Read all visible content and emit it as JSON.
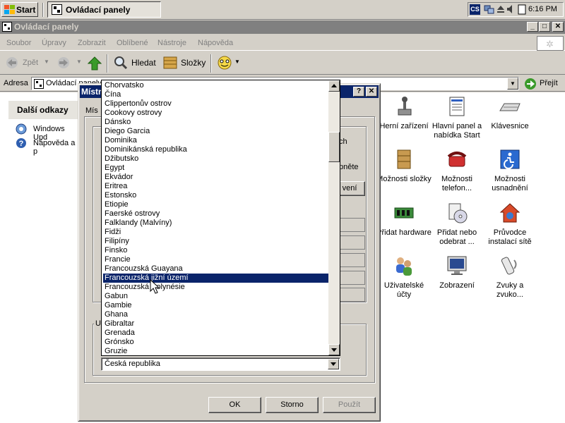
{
  "taskbar": {
    "start_label": "Start",
    "task_label": "Ovládací panely",
    "tray_lang": "CS",
    "clock": "6:16 PM"
  },
  "window": {
    "title": "Ovládací panely",
    "minimize": "_",
    "maximize": "□",
    "close": "✕"
  },
  "menu": [
    "Soubor",
    "Úpravy",
    "Zobrazit",
    "Oblíbené",
    "Nástroje",
    "Nápověda"
  ],
  "toolbar": {
    "back": "Zpět",
    "search": "Hledat",
    "folders": "Složky"
  },
  "address": {
    "label": "Adresa",
    "value": "Ovládací panely",
    "go": "Přejít"
  },
  "left_panel": {
    "heading": "Další odkazy",
    "links": [
      "Windows Upd",
      "Nápověda a p"
    ]
  },
  "cp_items": [
    {
      "label": "Herní zařízení"
    },
    {
      "label": "Hlavní panel a nabídka Start"
    },
    {
      "label": "Klávesnice"
    },
    {
      "label": "Možnosti složky"
    },
    {
      "label": "Možnosti telefon..."
    },
    {
      "label": "Možnosti usnadnění"
    },
    {
      "label": "Přidat hardware"
    },
    {
      "label": "Přidat nebo odebrat ..."
    },
    {
      "label": "Průvodce instalací sítě"
    },
    {
      "label": "Uživatelské účty"
    },
    {
      "label": "Zobrazení"
    },
    {
      "label": "Zvuky a zvuko..."
    }
  ],
  "dialog": {
    "title_partial": "Místn",
    "help": "?",
    "close": "✕",
    "tab_partial": "Mís",
    "frag_ch": "ch",
    "frag_pnete": "pněte",
    "frag_veni": "vení",
    "group2_partial": "U",
    "ok": "OK",
    "cancel": "Storno",
    "apply": "Použít"
  },
  "country_list": {
    "items": [
      "Chorvatsko",
      "Čína",
      "Clippertonův ostrov",
      "Cookovy ostrovy",
      "Dánsko",
      "Diego Garcia",
      "Dominika",
      "Dominikánská republika",
      "Džibutsko",
      "Egypt",
      "Ekvádor",
      "Eritrea",
      "Estonsko",
      "Etiopie",
      "Faerské ostrovy",
      "Falklandy (Malvíny)",
      "Fidži",
      "Filipíny",
      "Finsko",
      "Francie",
      "Francouzská Guayana",
      "Francouzská jižní území",
      "Francouzská Polynésie",
      "Gabun",
      "Gambie",
      "Ghana",
      "Gibraltar",
      "Grenada",
      "Grónsko",
      "Gruzie"
    ],
    "selected": "Francouzská jižní území",
    "combo_value": "Česká republika"
  }
}
